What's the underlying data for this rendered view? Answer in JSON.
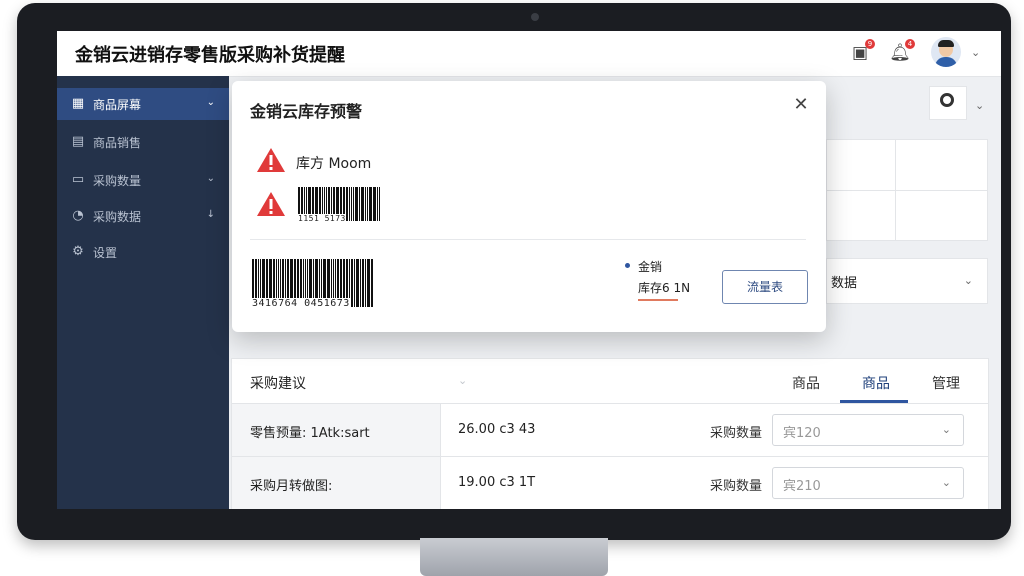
{
  "header": {
    "title": "金销云进销存零售版采购补货提醒",
    "badges": {
      "messages": "9",
      "notifications": "4"
    }
  },
  "sidebar": {
    "items": [
      {
        "label": "商品屏幕",
        "icon": "grid-icon"
      },
      {
        "label": "商品销售",
        "icon": "clipboard-icon"
      },
      {
        "label": "采购数量",
        "icon": "document-icon"
      },
      {
        "label": "采购数据",
        "icon": "gauge-icon"
      },
      {
        "label": "设置",
        "icon": "gear-icon"
      }
    ]
  },
  "background": {
    "select_label": "数据"
  },
  "purchase_panel": {
    "title": "采购建议",
    "tabs": [
      "商品",
      "商品",
      "管理"
    ],
    "rows": [
      {
        "name": "零售预量: 1Atk:sart",
        "value": "26.00 c3 43",
        "qty_label": "采购数量",
        "qty_value": "宾120"
      },
      {
        "name": "采购月转做图:",
        "value": "19.00 c3 1T",
        "qty_label": "采购数量",
        "qty_value": "宾210"
      }
    ]
  },
  "modal": {
    "title": "金销云库存预警",
    "warning_text": "库方 Moom",
    "barcode_small": "1151 5173",
    "barcode_large": "3416764 0451673",
    "info_line_1": "金销",
    "info_line_2": "库存6 1N",
    "button_label": "流量表"
  },
  "colors": {
    "sidebar_bg": "#24324a",
    "sidebar_active": "#2f4c82",
    "accent": "#2f56a0",
    "warning": "#e03a3a"
  }
}
